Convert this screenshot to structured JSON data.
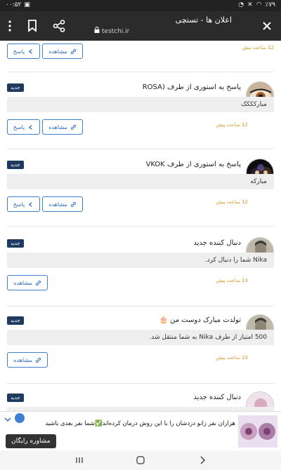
{
  "status_bar": {
    "time": "۰۰:۵۲",
    "battery": "٪۷۹"
  },
  "browser": {
    "title": "اعلان ها - تستچی",
    "url": "testchi.ir"
  },
  "labels": {
    "reply": "پاسخ",
    "view": "مشاهده",
    "new_badge": "جدید"
  },
  "notifications": [
    {
      "title": "پاسخ به استوری از طرف (ROSA",
      "message": "مبارکککک",
      "time": "12 ساعت پیش",
      "has_reply": true
    },
    {
      "title": "پاسخ به استوری از طرف VKOK",
      "message": "مبارکه",
      "time": "12 ساعت پیش",
      "has_reply": true
    },
    {
      "title": "دنبال کننده جدید",
      "message": "Nika شما را دنبال کرد.",
      "time": "13 ساعت پیش",
      "has_reply": false
    },
    {
      "title": "تولدت مبارک دوست من 🎂",
      "message": "500 امتیاز از طرف Nika به شما منتقل شد.",
      "time": "13 ساعت پیش",
      "has_reply": false
    },
    {
      "title": "دنبال کننده جدید",
      "message": "",
      "time": "",
      "has_reply": false
    }
  ],
  "top_partial": {
    "time": "12 ساعت پیش"
  },
  "ad": {
    "text": "هزاران نفر زانو دردشان را با این روش درمان کرده‌اند✅شما نفر بعدی باشید",
    "cta": "مشاوره رایگان"
  },
  "icons": {
    "close": "close-icon",
    "share": "share-icon",
    "bookmark": "bookmark-icon",
    "menu": "more-vertical-icon",
    "lock": "lock-icon",
    "link": "link-icon",
    "reply": "reply-icon"
  },
  "colors": {
    "badge": "#1f3a61",
    "button_outline": "#3f7fd1",
    "time": "#d19a1b",
    "message_bg": "#eeeeee",
    "appbar": "#2b2b2b"
  }
}
